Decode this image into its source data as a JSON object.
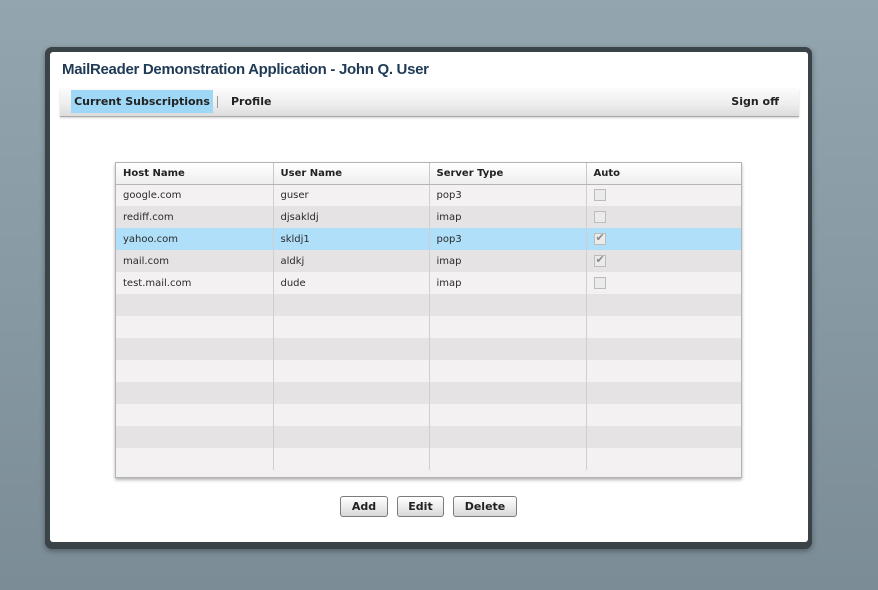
{
  "app": {
    "title": "MailReader Demonstration Application - John Q. User"
  },
  "nav": {
    "tabs": [
      {
        "label": "Current Subscriptions",
        "selected": true
      },
      {
        "label": "Profile",
        "selected": false
      }
    ],
    "sign_off": "Sign off"
  },
  "grid": {
    "columns": [
      "Host Name",
      "User Name",
      "Server Type",
      "Auto"
    ],
    "rows": [
      {
        "host": "google.com",
        "user": "guser",
        "type": "pop3",
        "auto": false,
        "selected": false
      },
      {
        "host": "rediff.com",
        "user": "djsakldj",
        "type": "imap",
        "auto": false,
        "selected": false
      },
      {
        "host": "yahoo.com",
        "user": "skldj1",
        "type": "pop3",
        "auto": true,
        "selected": true
      },
      {
        "host": "mail.com",
        "user": "aldkj",
        "type": "imap",
        "auto": true,
        "selected": false
      },
      {
        "host": "test.mail.com",
        "user": "dude",
        "type": "imap",
        "auto": false,
        "selected": false
      }
    ]
  },
  "buttons": {
    "add": "Add",
    "edit": "Edit",
    "delete": "Delete"
  },
  "colors": {
    "tab_active": "#9fd8f7",
    "row_selected": "#b0dff9",
    "title_text": "#1e3a55"
  }
}
